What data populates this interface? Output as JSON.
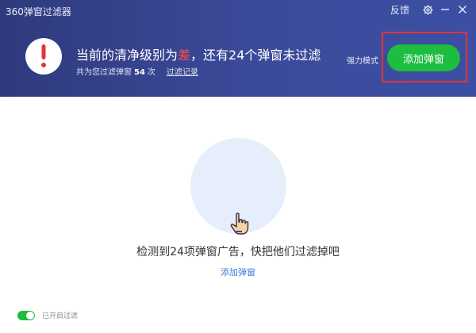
{
  "window": {
    "title": "360弹窗过滤器",
    "feedback_label": "反馈"
  },
  "status": {
    "prefix": "当前的清净级别为",
    "level": "差",
    "suffix": "，还有24个弹窗未过滤",
    "sub_prefix": "共为您过滤弹窗",
    "filtered_count": "54",
    "sub_suffix": "次",
    "records_link": "过滤记录"
  },
  "actions": {
    "mode_label": "强力模式",
    "add_button": "添加弹窗"
  },
  "main": {
    "message": "检测到24项弹窗广告，快把他们过滤掉吧",
    "add_link": "添加弹窗"
  },
  "footer": {
    "toggle_label": "已开启过滤",
    "toggle_on": true
  },
  "colors": {
    "header": "#3b4a9a",
    "accent_green": "#1dbd3f",
    "alert_red": "#e0353a",
    "link_blue": "#3a78d8"
  }
}
